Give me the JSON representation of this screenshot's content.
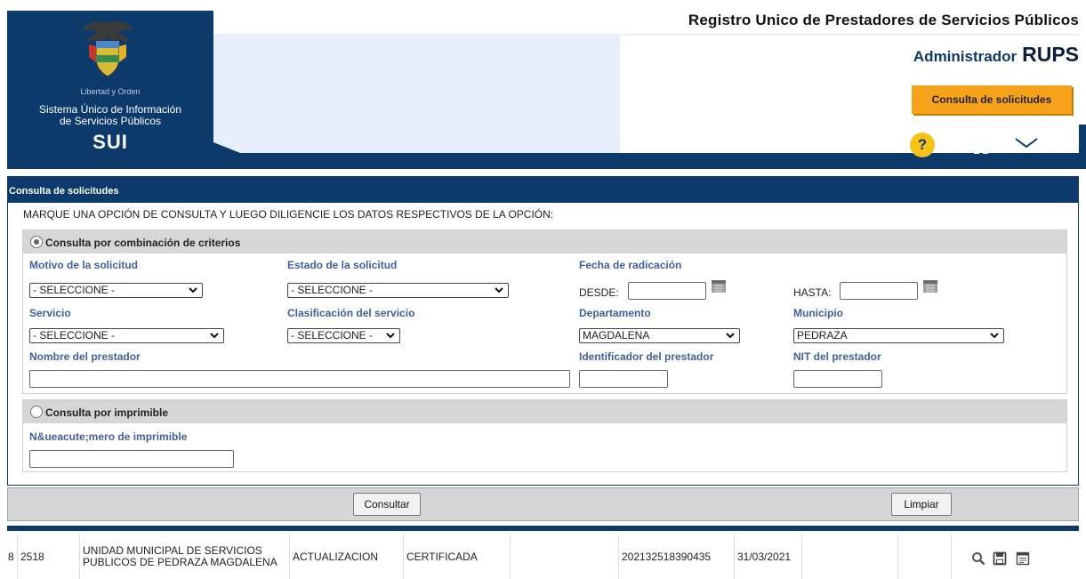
{
  "header": {
    "title": "Registro Unico de Prestadores de Servicios Públicos",
    "admin_label": "Administrador",
    "admin_brand": "RUPS",
    "consulta_button": "Consulta de solicitudes",
    "logo": {
      "motto": "Libertad y Orden",
      "title_line1": "Sistema Único de Información",
      "title_line2": "de Servicios Públicos",
      "brand": "SUI"
    },
    "icons": [
      "help-icon",
      "home-icon",
      "mail-icon"
    ]
  },
  "form": {
    "title": "Consulta de solicitudes",
    "instructions": "MARQUE UNA OPCIÓN DE CONSULTA Y LUEGO DILIGENCIE LOS DATOS RESPECTIVOS DE LA OPCIÓN:",
    "section1": {
      "label": "Consulta por combinación de criterios",
      "selected": true,
      "fields": {
        "motivo": {
          "label": "Motivo de la solicitud",
          "value": "- SELECCIONE -"
        },
        "estado": {
          "label": "Estado de la solicitud",
          "value": "- SELECCIONE -"
        },
        "fecha": {
          "label": "Fecha de radicación",
          "desde": "DESDE:",
          "hasta": "HASTA:",
          "desde_value": "",
          "hasta_value": ""
        },
        "servicio": {
          "label": "Servicio",
          "value": "- SELECCIONE -"
        },
        "clasificacion": {
          "label": "Clasificación del servicio",
          "value": "- SELECCIONE -"
        },
        "departamento": {
          "label": "Departamento",
          "value": "MAGDALENA"
        },
        "municipio": {
          "label": "Municipio",
          "value": "PEDRAZA"
        },
        "nombre": {
          "label": "Nombre del prestador",
          "value": ""
        },
        "identificador": {
          "label": "Identificador del prestador",
          "value": ""
        },
        "nit": {
          "label": "NIT del prestador",
          "value": ""
        }
      }
    },
    "section2": {
      "label": "Consulta por imprimible",
      "selected": false,
      "field_label": "N&ueacute;mero de imprimible",
      "value": ""
    },
    "buttons": {
      "consultar": "Consultar",
      "limpiar": "Limpiar"
    }
  },
  "results": {
    "rows": [
      {
        "index": "8",
        "id": "2518",
        "prestador": "UNIDAD MUNICIPAL DE SERVICIOS PUBLICOS DE PEDRAZA MAGDALENA",
        "motivo": "ACTUALIZACION",
        "estado": "CERTIFICADA",
        "blank1": "",
        "radicado": "202132518390435",
        "fecha": "31/03/2021",
        "blank2": "",
        "blank3": "",
        "actions": [
          "search-icon",
          "save-icon",
          "document-icon"
        ]
      }
    ]
  },
  "colors": {
    "navy": "#0c3a6b",
    "accent_orange": "#f7a21b",
    "help_yellow": "#f7c31b",
    "label_blue": "#3f5fa0",
    "section_gray": "#d6d6d6"
  }
}
